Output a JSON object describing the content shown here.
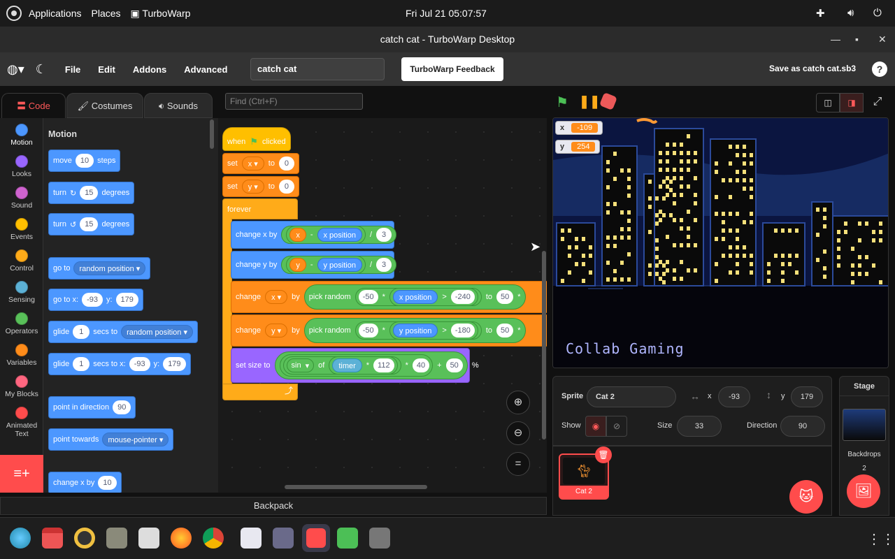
{
  "sysbar": {
    "applications": "Applications",
    "places": "Places",
    "turbowarp": "TurboWarp",
    "clock": "Fri Jul 21  05:07:57"
  },
  "window": {
    "title": "catch cat - TurboWarp Desktop"
  },
  "menubar": {
    "file": "File",
    "edit": "Edit",
    "addons": "Addons",
    "advanced": "Advanced",
    "project_title": "catch cat",
    "feedback": "TurboWarp Feedback",
    "save_as": "Save as catch cat.sb3",
    "help": "?"
  },
  "tabs": {
    "code": "Code",
    "costumes": "Costumes",
    "sounds": "Sounds"
  },
  "find": {
    "placeholder": "Find (Ctrl+F)"
  },
  "categories": [
    {
      "label": "Motion",
      "color": "#4c97ff"
    },
    {
      "label": "Looks",
      "color": "#9966ff"
    },
    {
      "label": "Sound",
      "color": "#cf63cf"
    },
    {
      "label": "Events",
      "color": "#ffbf00"
    },
    {
      "label": "Control",
      "color": "#ffab19"
    },
    {
      "label": "Sensing",
      "color": "#5cb1d6"
    },
    {
      "label": "Operators",
      "color": "#59c059"
    },
    {
      "label": "Variables",
      "color": "#ff8c1a"
    },
    {
      "label": "My Blocks",
      "color": "#ff6680"
    },
    {
      "label": "Animated Text",
      "color": "#ff4c4c"
    }
  ],
  "palette": {
    "heading": "Motion",
    "move": {
      "a": "move",
      "v": "10",
      "b": "steps"
    },
    "turn_r": {
      "a": "turn",
      "v": "15",
      "b": "degrees"
    },
    "turn_l": {
      "a": "turn",
      "v": "15",
      "b": "degrees"
    },
    "goto": {
      "a": "go to",
      "v": "random position"
    },
    "gotoxy": {
      "a": "go to x:",
      "x": "-93",
      "b": "y:",
      "y": "179"
    },
    "glide": {
      "a": "glide",
      "v": "1",
      "b": "secs to",
      "c": "random position"
    },
    "glidexy": {
      "a": "glide",
      "v": "1",
      "b": "secs to x:",
      "x": "-93",
      "c": "y:",
      "y": "179"
    },
    "point": {
      "a": "point in direction",
      "v": "90"
    },
    "towards": {
      "a": "point towards",
      "v": "mouse-pointer"
    },
    "changex": {
      "a": "change x by",
      "v": "10"
    }
  },
  "script": {
    "hat": {
      "a": "when",
      "b": "clicked"
    },
    "setx": {
      "a": "set",
      "var": "x",
      "b": "to",
      "v": "0"
    },
    "sety": {
      "a": "set",
      "var": "y",
      "b": "to",
      "v": "0"
    },
    "forever": "forever",
    "cx": {
      "a": "change x by",
      "v1": "x",
      "op": "-",
      "r": "x position",
      "div": "/",
      "v2": "3"
    },
    "cy": {
      "a": "change y by",
      "v1": "y",
      "op": "-",
      "r": "y position",
      "div": "/",
      "v2": "3"
    },
    "chx": {
      "a": "change",
      "var": "x",
      "b": "by",
      "pr": "pick random",
      "n1": "-50",
      "m": "*",
      "r": "x position",
      "gt": ">",
      "n2": "-240",
      "to": "to",
      "n3": "50",
      "m2": "*"
    },
    "chy": {
      "a": "change",
      "var": "y",
      "b": "by",
      "pr": "pick random",
      "n1": "-50",
      "m": "*",
      "r": "y position",
      "gt": ">",
      "n2": "-180",
      "to": "to",
      "n3": "50",
      "m2": "*"
    },
    "size": {
      "a": "set size to",
      "fn": "sin",
      "of": "of",
      "t": "timer",
      "m": "*",
      "n1": "112",
      "m2": "*",
      "n2": "40",
      "p": "+",
      "n3": "50",
      "pct": "%"
    }
  },
  "backpack": "Backpack",
  "stage": {
    "mon_x": {
      "label": "x",
      "value": "-109"
    },
    "mon_y": {
      "label": "y",
      "value": "254"
    },
    "text": "Collab Gaming"
  },
  "sprite_info": {
    "sprite_label": "Sprite",
    "sprite_name": "Cat 2",
    "x_label": "x",
    "x": "-93",
    "y_label": "y",
    "y": "179",
    "show_label": "Show",
    "size_label": "Size",
    "size": "33",
    "direction_label": "Direction",
    "direction": "90"
  },
  "sprite_list": [
    {
      "name": "Cat 2"
    }
  ],
  "stage_panel": {
    "title": "Stage",
    "backdrops_label": "Backdrops",
    "backdrops": "2"
  },
  "colors": {
    "accent": "#ff4c4c",
    "motion": "#4c97ff",
    "events": "#ffbf00",
    "control": "#ffab19",
    "operators": "#59c059",
    "variables": "#ff8c1a",
    "looks": "#9966ff",
    "sensing": "#5cb1d6"
  }
}
